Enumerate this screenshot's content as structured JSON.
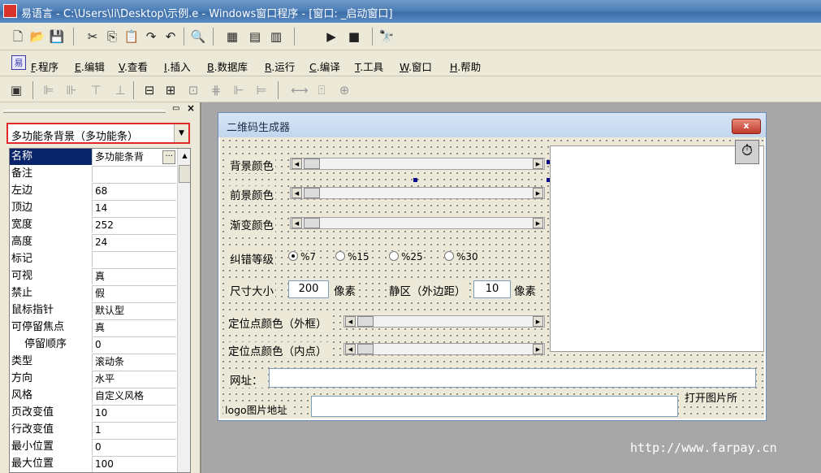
{
  "window": {
    "title": "易语言 - C:\\Users\\li\\Desktop\\示例.e - Windows窗口程序 - [窗口: _启动窗口]"
  },
  "toolbar1": {
    "icons": [
      "new-file-icon",
      "open-folder-icon",
      "save-icon",
      "cut-icon",
      "copy-icon",
      "paste-icon",
      "redo-icon",
      "undo-icon",
      "find-icon",
      "layout1-icon",
      "layout2-icon",
      "layout3-icon",
      "run-icon",
      "stop-icon",
      "debug-icon"
    ]
  },
  "menu": {
    "items": [
      {
        "key": "F",
        "label": ".程序"
      },
      {
        "key": "E",
        "label": ".编辑"
      },
      {
        "key": "V",
        "label": ".查看"
      },
      {
        "key": "I",
        "label": ".插入"
      },
      {
        "key": "B",
        "label": ".数据库"
      },
      {
        "key": "R",
        "label": ".运行"
      },
      {
        "key": "C",
        "label": ".编译"
      },
      {
        "key": "T",
        "label": ".工具"
      },
      {
        "key": "W",
        "label": ".窗口"
      },
      {
        "key": "H",
        "label": ".帮助"
      }
    ]
  },
  "panel": {
    "selector": "多功能条背景（多功能条）",
    "properties": [
      {
        "name": "名称",
        "value": "多功能条背"
      },
      {
        "name": "备注",
        "value": ""
      },
      {
        "name": "左边",
        "value": "68"
      },
      {
        "name": "顶边",
        "value": "14"
      },
      {
        "name": "宽度",
        "value": "252"
      },
      {
        "name": "高度",
        "value": "24"
      },
      {
        "name": "标记",
        "value": ""
      },
      {
        "name": "可视",
        "value": "真"
      },
      {
        "name": "禁止",
        "value": "假"
      },
      {
        "name": "鼠标指针",
        "value": "默认型"
      },
      {
        "name": "可停留焦点",
        "value": "真"
      },
      {
        "name": "停留顺序",
        "value": "0"
      },
      {
        "name": "类型",
        "value": "滚动条"
      },
      {
        "name": "方向",
        "value": "水平"
      },
      {
        "name": "风格",
        "value": "自定义风格"
      },
      {
        "name": "页改变值",
        "value": "10"
      },
      {
        "name": "行改变值",
        "value": "1"
      },
      {
        "name": "最小位置",
        "value": "0"
      },
      {
        "name": "最大位置",
        "value": "100"
      }
    ],
    "ellipsis": "···"
  },
  "form": {
    "title": "二维码生成器",
    "close": "x",
    "labels": {
      "bg": "背景颜色",
      "fg": "前景颜色",
      "grad": "渐变颜色",
      "ecc": "纠错等级",
      "size": "尺寸大小",
      "px1": "像素",
      "quiet": "静区（外边距）",
      "px2": "像素",
      "outer": "定位点颜色（外框）",
      "inner": "定位点颜色（内点）",
      "url": "网址：",
      "logo": "logo图片地址"
    },
    "radios": [
      "%7",
      "%15",
      "%25",
      "%30"
    ],
    "size_value": "200",
    "quiet_value": "10",
    "open_button": "打开图片所"
  },
  "watermark": "http://www.farpay.cn"
}
